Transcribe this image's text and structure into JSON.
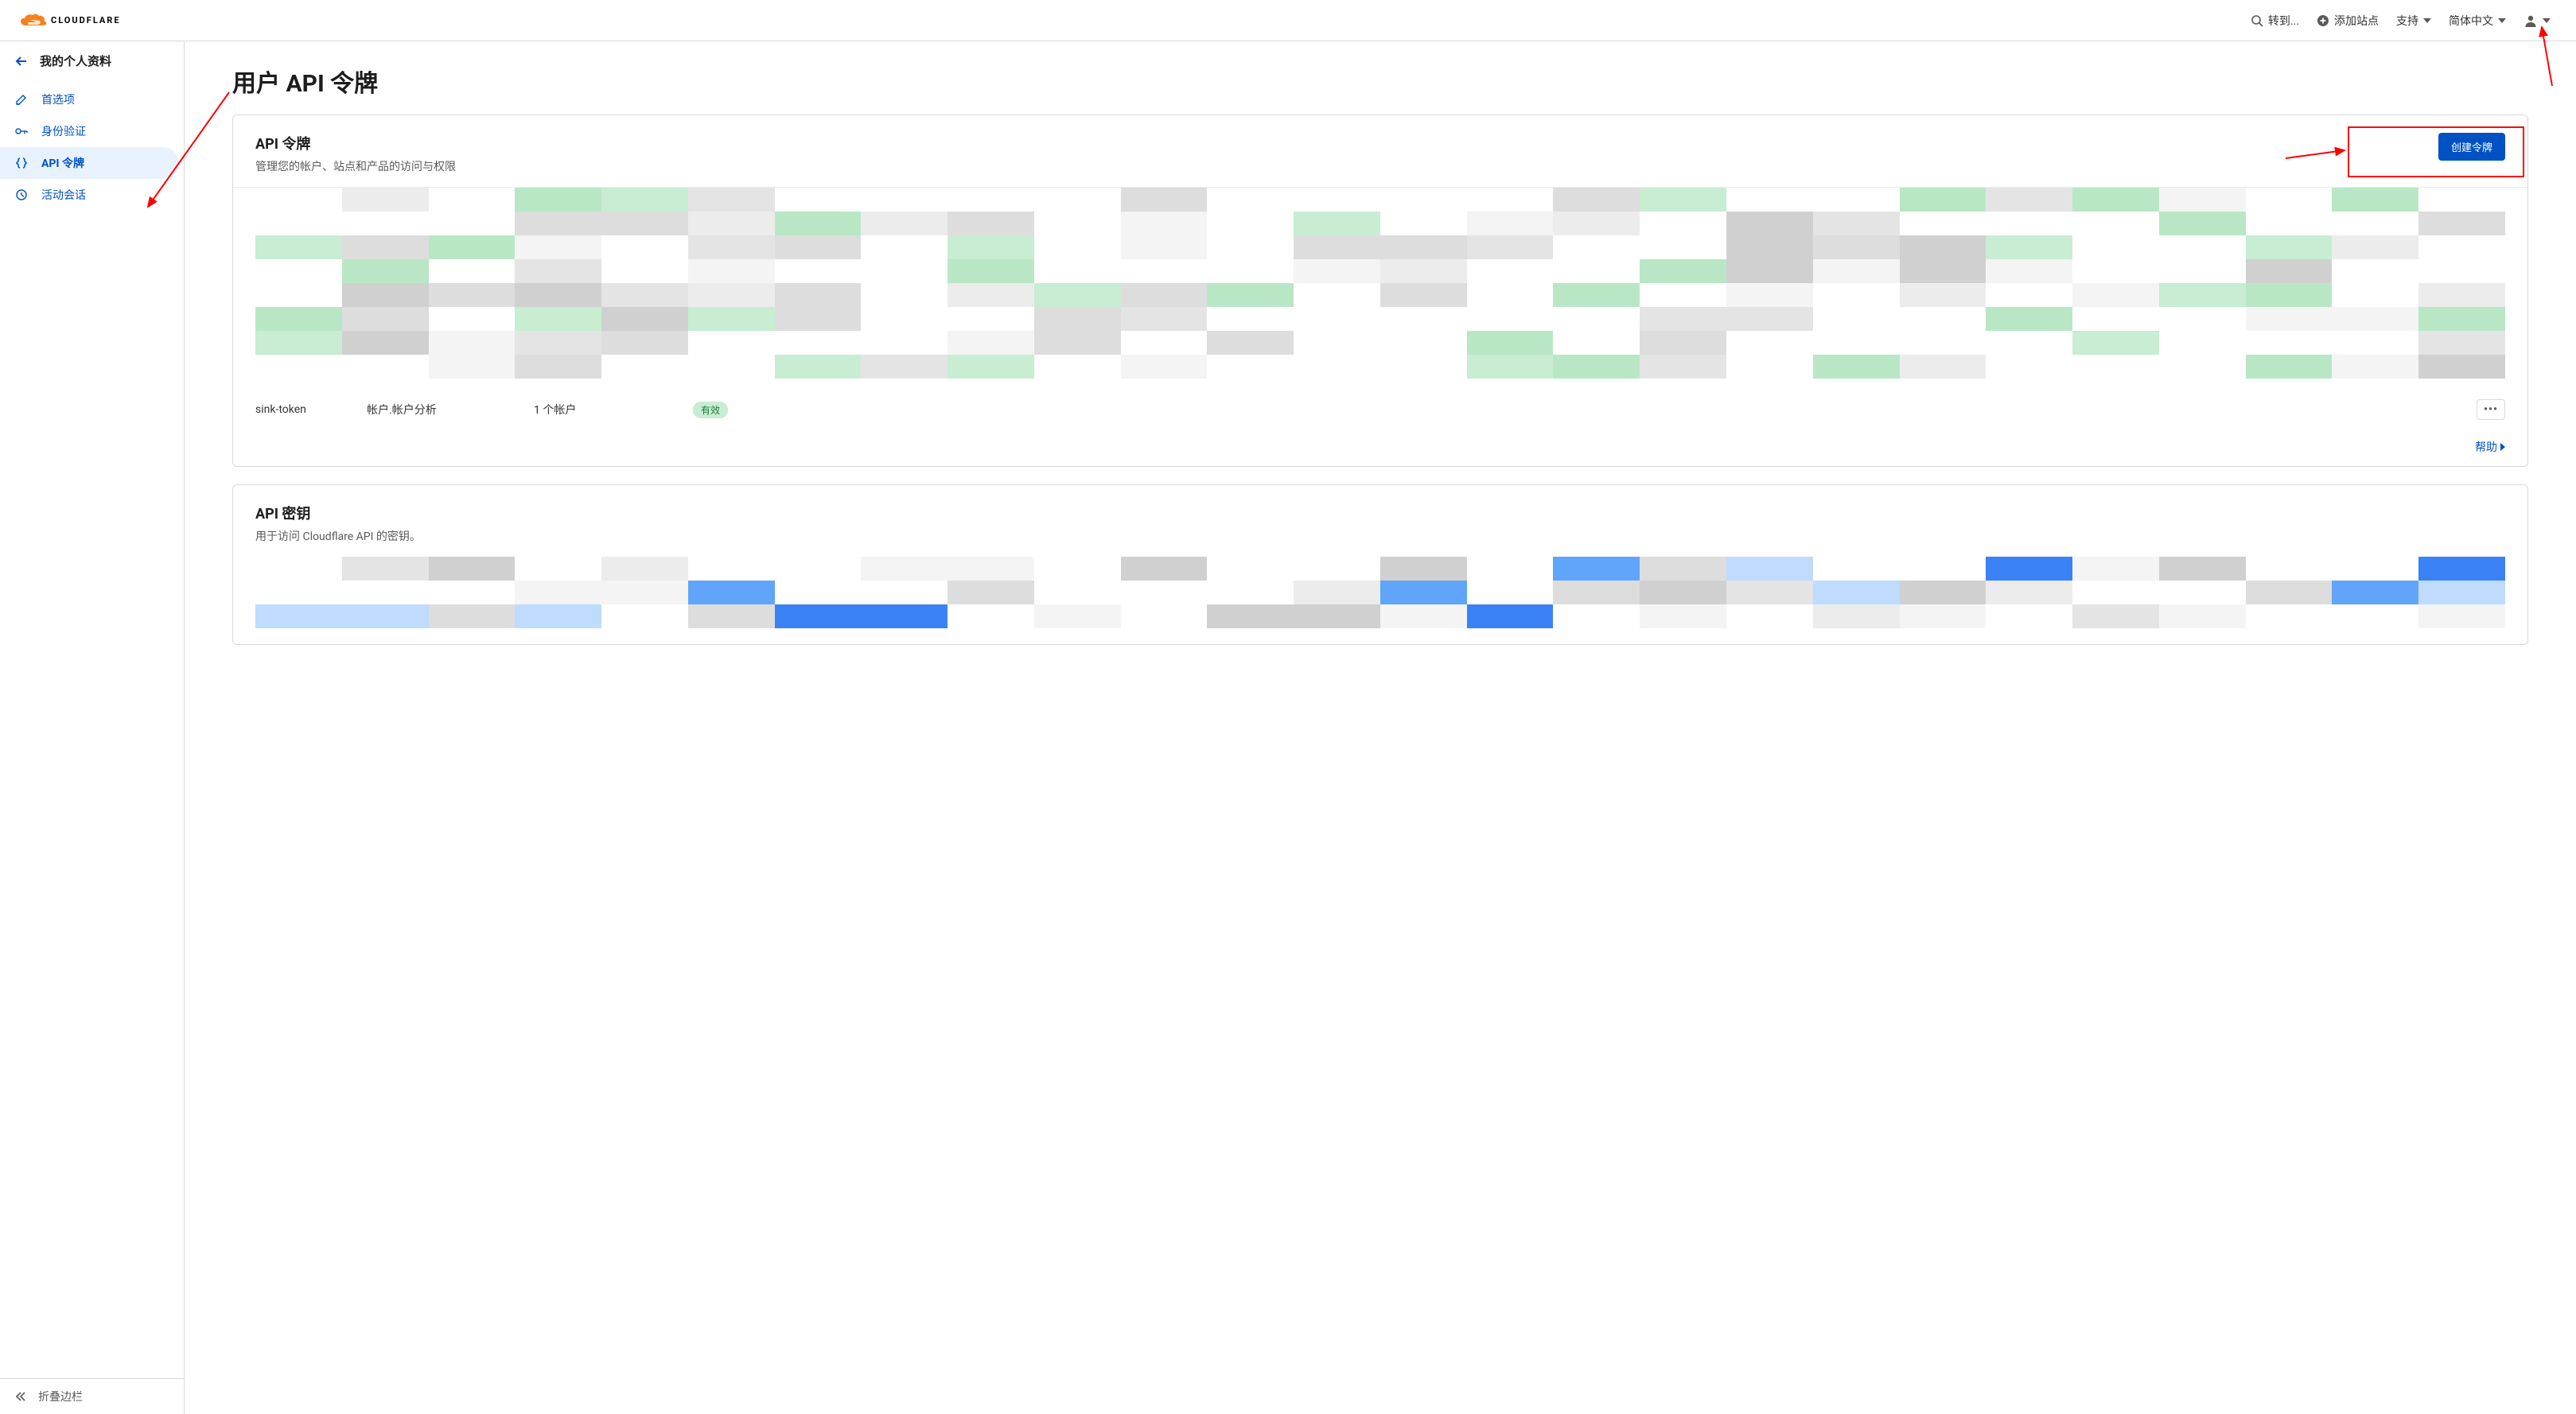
{
  "brand": "CLOUDFLARE",
  "header": {
    "goto": "转到...",
    "add_site": "添加站点",
    "support": "支持",
    "language": "简体中文"
  },
  "sidebar": {
    "title": "我的个人资料",
    "items": [
      {
        "label": "首选项"
      },
      {
        "label": "身份验证"
      },
      {
        "label": "API 令牌"
      },
      {
        "label": "活动会话"
      }
    ],
    "active_index": 2,
    "collapse": "折叠边栏"
  },
  "page": {
    "title": "用户 API 令牌"
  },
  "tokens_card": {
    "title": "API 令牌",
    "subtitle": "管理您的帐户、站点和产品的访问与权限",
    "create_button": "创建令牌",
    "row": {
      "name": "sink-token",
      "permissions": "帐户.帐户分析",
      "accounts": "1 个帐户",
      "status": "有效"
    },
    "help": "帮助"
  },
  "keys_card": {
    "title": "API 密钥",
    "subtitle": "用于访问 Cloudflare API 的密钥。"
  }
}
